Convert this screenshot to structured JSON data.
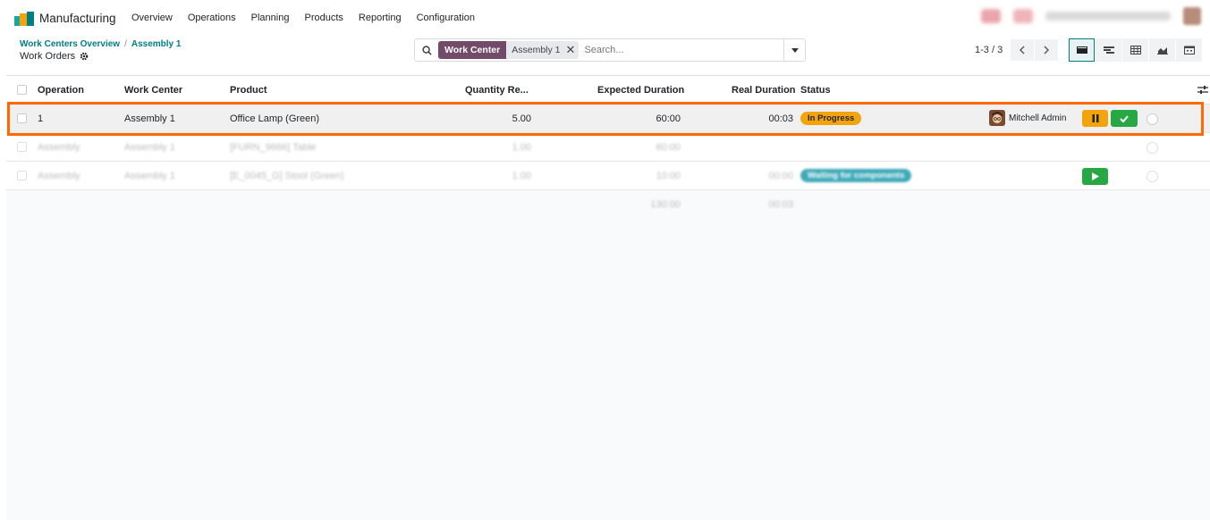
{
  "app": {
    "name": "Manufacturing"
  },
  "menu": [
    "Overview",
    "Operations",
    "Planning",
    "Products",
    "Reporting",
    "Configuration"
  ],
  "breadcrumb": {
    "parent": "Work Centers Overview",
    "separator": "/",
    "current": "Assembly 1"
  },
  "page_title": "Work Orders",
  "search": {
    "facet_label": "Work Center",
    "facet_value": "Assembly 1",
    "placeholder": "Search..."
  },
  "pager": {
    "text": "1-3 / 3"
  },
  "columns": {
    "operation": "Operation",
    "work_center": "Work Center",
    "product": "Product",
    "quantity": "Quantity Re...",
    "expected": "Expected Duration",
    "real": "Real Duration",
    "status": "Status"
  },
  "rows": [
    {
      "operation": "1",
      "work_center": "Assembly 1",
      "product": "Office Lamp (Green)",
      "quantity": "5.00",
      "expected": "60:00",
      "real": "00:03",
      "status": "In Progress",
      "user": "Mitchell Admin"
    },
    {
      "operation": "Assembly",
      "work_center": "Assembly 1",
      "product": "[FURN_9666] Table",
      "quantity": "1.00",
      "expected": "60:00",
      "real": "",
      "status": ""
    },
    {
      "operation": "Assembly",
      "work_center": "Assembly 1",
      "product": "[E_0045_G] Stool (Green)",
      "quantity": "1.00",
      "expected": "10:00",
      "real": "00:00",
      "status": "Waiting for components"
    }
  ],
  "totals": {
    "expected": "130:00",
    "real": "00:03"
  },
  "colors": {
    "brand": "#714b67",
    "accent": "#017e84",
    "warning": "#f3a40c",
    "success": "#28a745",
    "info": "#40aab9",
    "highlight": "#ff6a00"
  }
}
